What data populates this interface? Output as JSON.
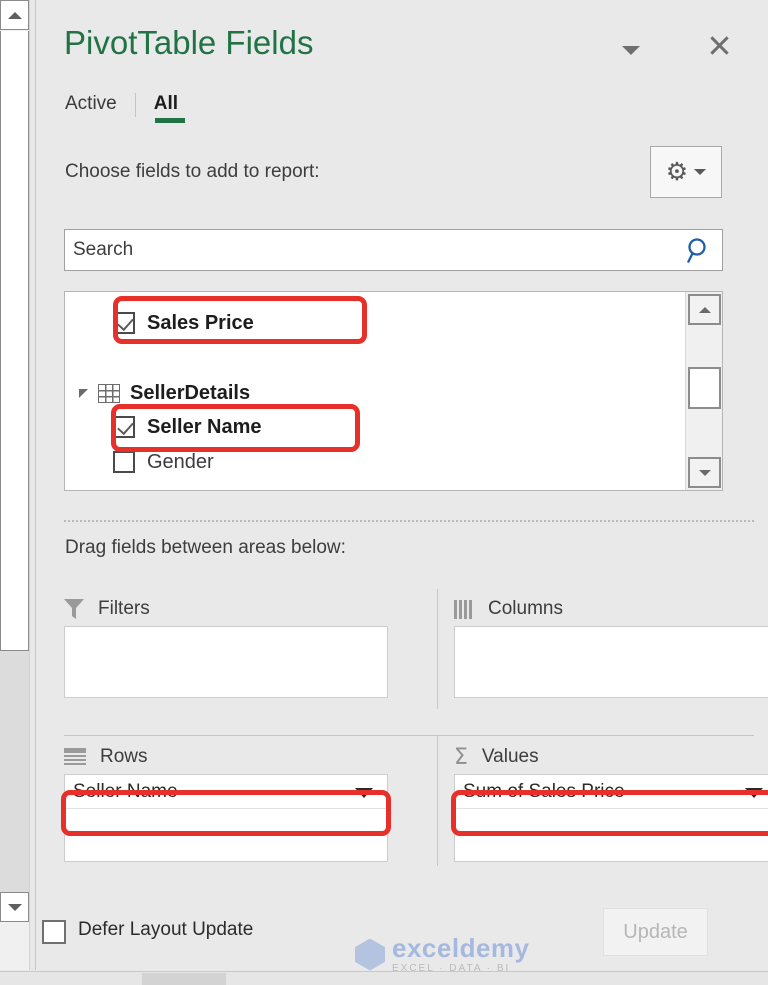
{
  "pane": {
    "title": "PivotTable Fields",
    "menu_icon": "chevron-down-icon",
    "close_icon": "close-icon"
  },
  "tabs": [
    {
      "label": "Active",
      "active": false
    },
    {
      "label": "All",
      "active": true
    }
  ],
  "choose_fields": {
    "label": "Choose fields to add to report:",
    "tools_icon": "gear-icon"
  },
  "search": {
    "value": "",
    "placeholder": "Search",
    "icon": "search-icon"
  },
  "fields_list": {
    "items": [
      {
        "label": "Sales Price",
        "checked": true,
        "bold": true,
        "highlighted": true
      },
      {
        "label": "Seller Name",
        "checked": true,
        "bold": true,
        "highlighted": true
      },
      {
        "label": "Gender",
        "checked": false,
        "bold": false,
        "highlighted": false
      }
    ],
    "table_group": {
      "name": "SellerDetails",
      "expand_icon": "collapse-triangle-icon",
      "table_icon": "table-icon"
    },
    "scrollbar": {
      "up_icon": "scroll-up-icon",
      "down_icon": "scroll-down-icon"
    }
  },
  "areas": {
    "instruction": "Drag fields between areas below:",
    "filters": {
      "title": "Filters",
      "icon": "filter-funnel-icon",
      "fields": []
    },
    "columns": {
      "title": "Columns",
      "icon": "columns-icon",
      "fields": []
    },
    "rows": {
      "title": "Rows",
      "icon": "rows-icon",
      "fields": [
        {
          "label": "Seller Name",
          "highlighted": true
        }
      ]
    },
    "values": {
      "title": "Values",
      "icon": "sigma-icon",
      "fields": [
        {
          "label": "Sum of Sales Price",
          "highlighted": true
        }
      ]
    }
  },
  "footer": {
    "defer_label": "Defer Layout Update",
    "defer_checked": false,
    "update_label": "Update",
    "update_enabled": false
  },
  "watermark": {
    "name": "exceldemy",
    "tagline": "EXCEL · DATA · BI"
  },
  "colors": {
    "accent_green": "#217346",
    "callout_red": "#e8302a",
    "pane_bg": "#e9e9e9",
    "search_blue": "#1f5fa8"
  }
}
